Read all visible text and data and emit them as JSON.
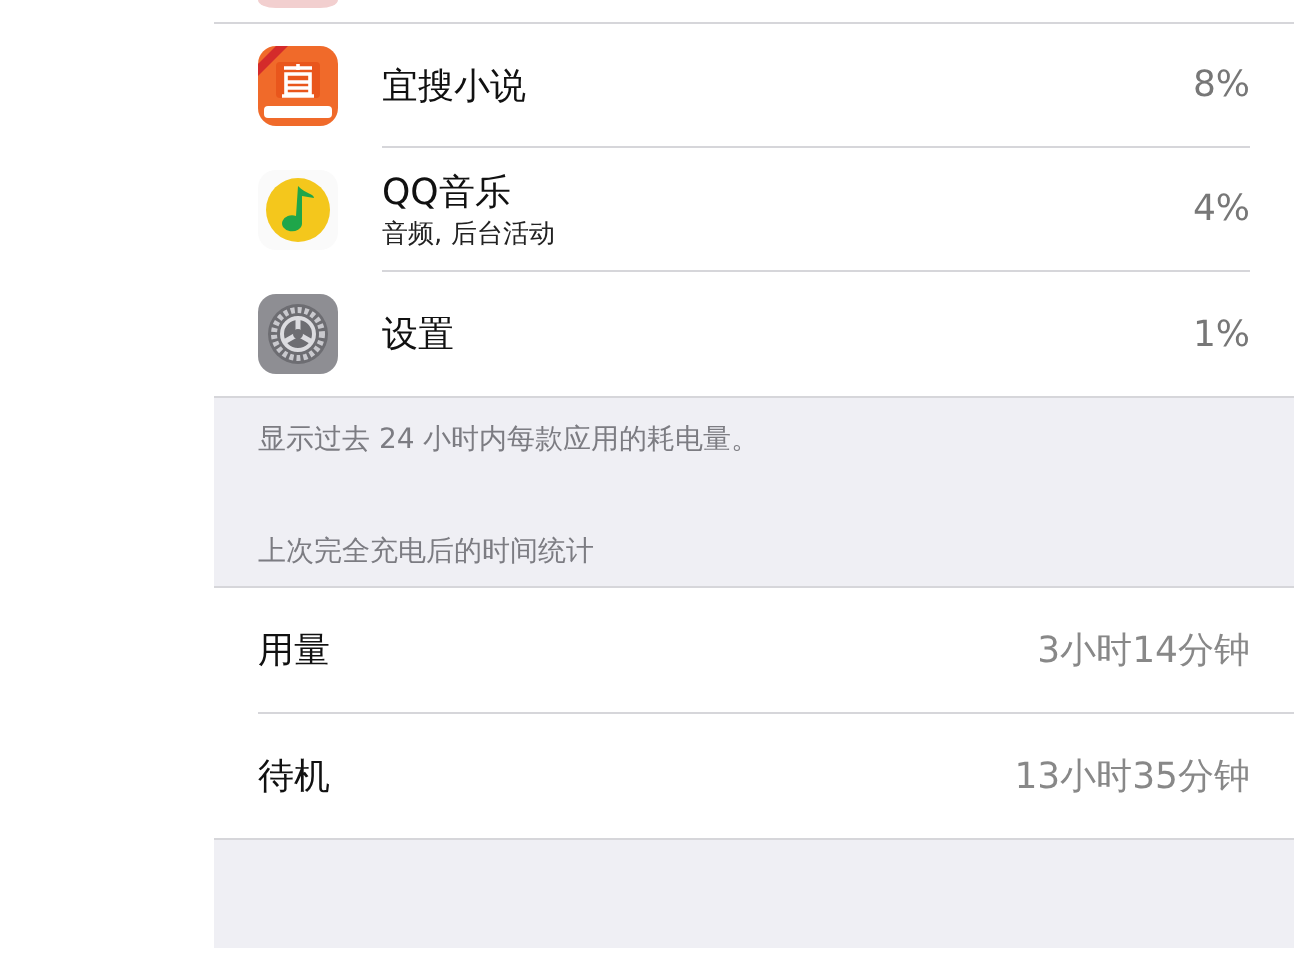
{
  "apps": [
    {
      "kind": "book",
      "name": "宜搜小说",
      "percent": "8%"
    },
    {
      "kind": "music",
      "name": "QQ音乐",
      "detail": "音频, 后台活动",
      "percent": "4%"
    },
    {
      "kind": "gear",
      "name": "设置",
      "percent": "1%"
    }
  ],
  "note": "显示过去 24 小时内每款应用的耗电量。",
  "time_section": {
    "header": "上次完全充电后的时间统计",
    "rows": [
      {
        "label": "用量",
        "value": "3小时14分钟"
      },
      {
        "label": "待机",
        "value": "13小时35分钟"
      }
    ]
  }
}
